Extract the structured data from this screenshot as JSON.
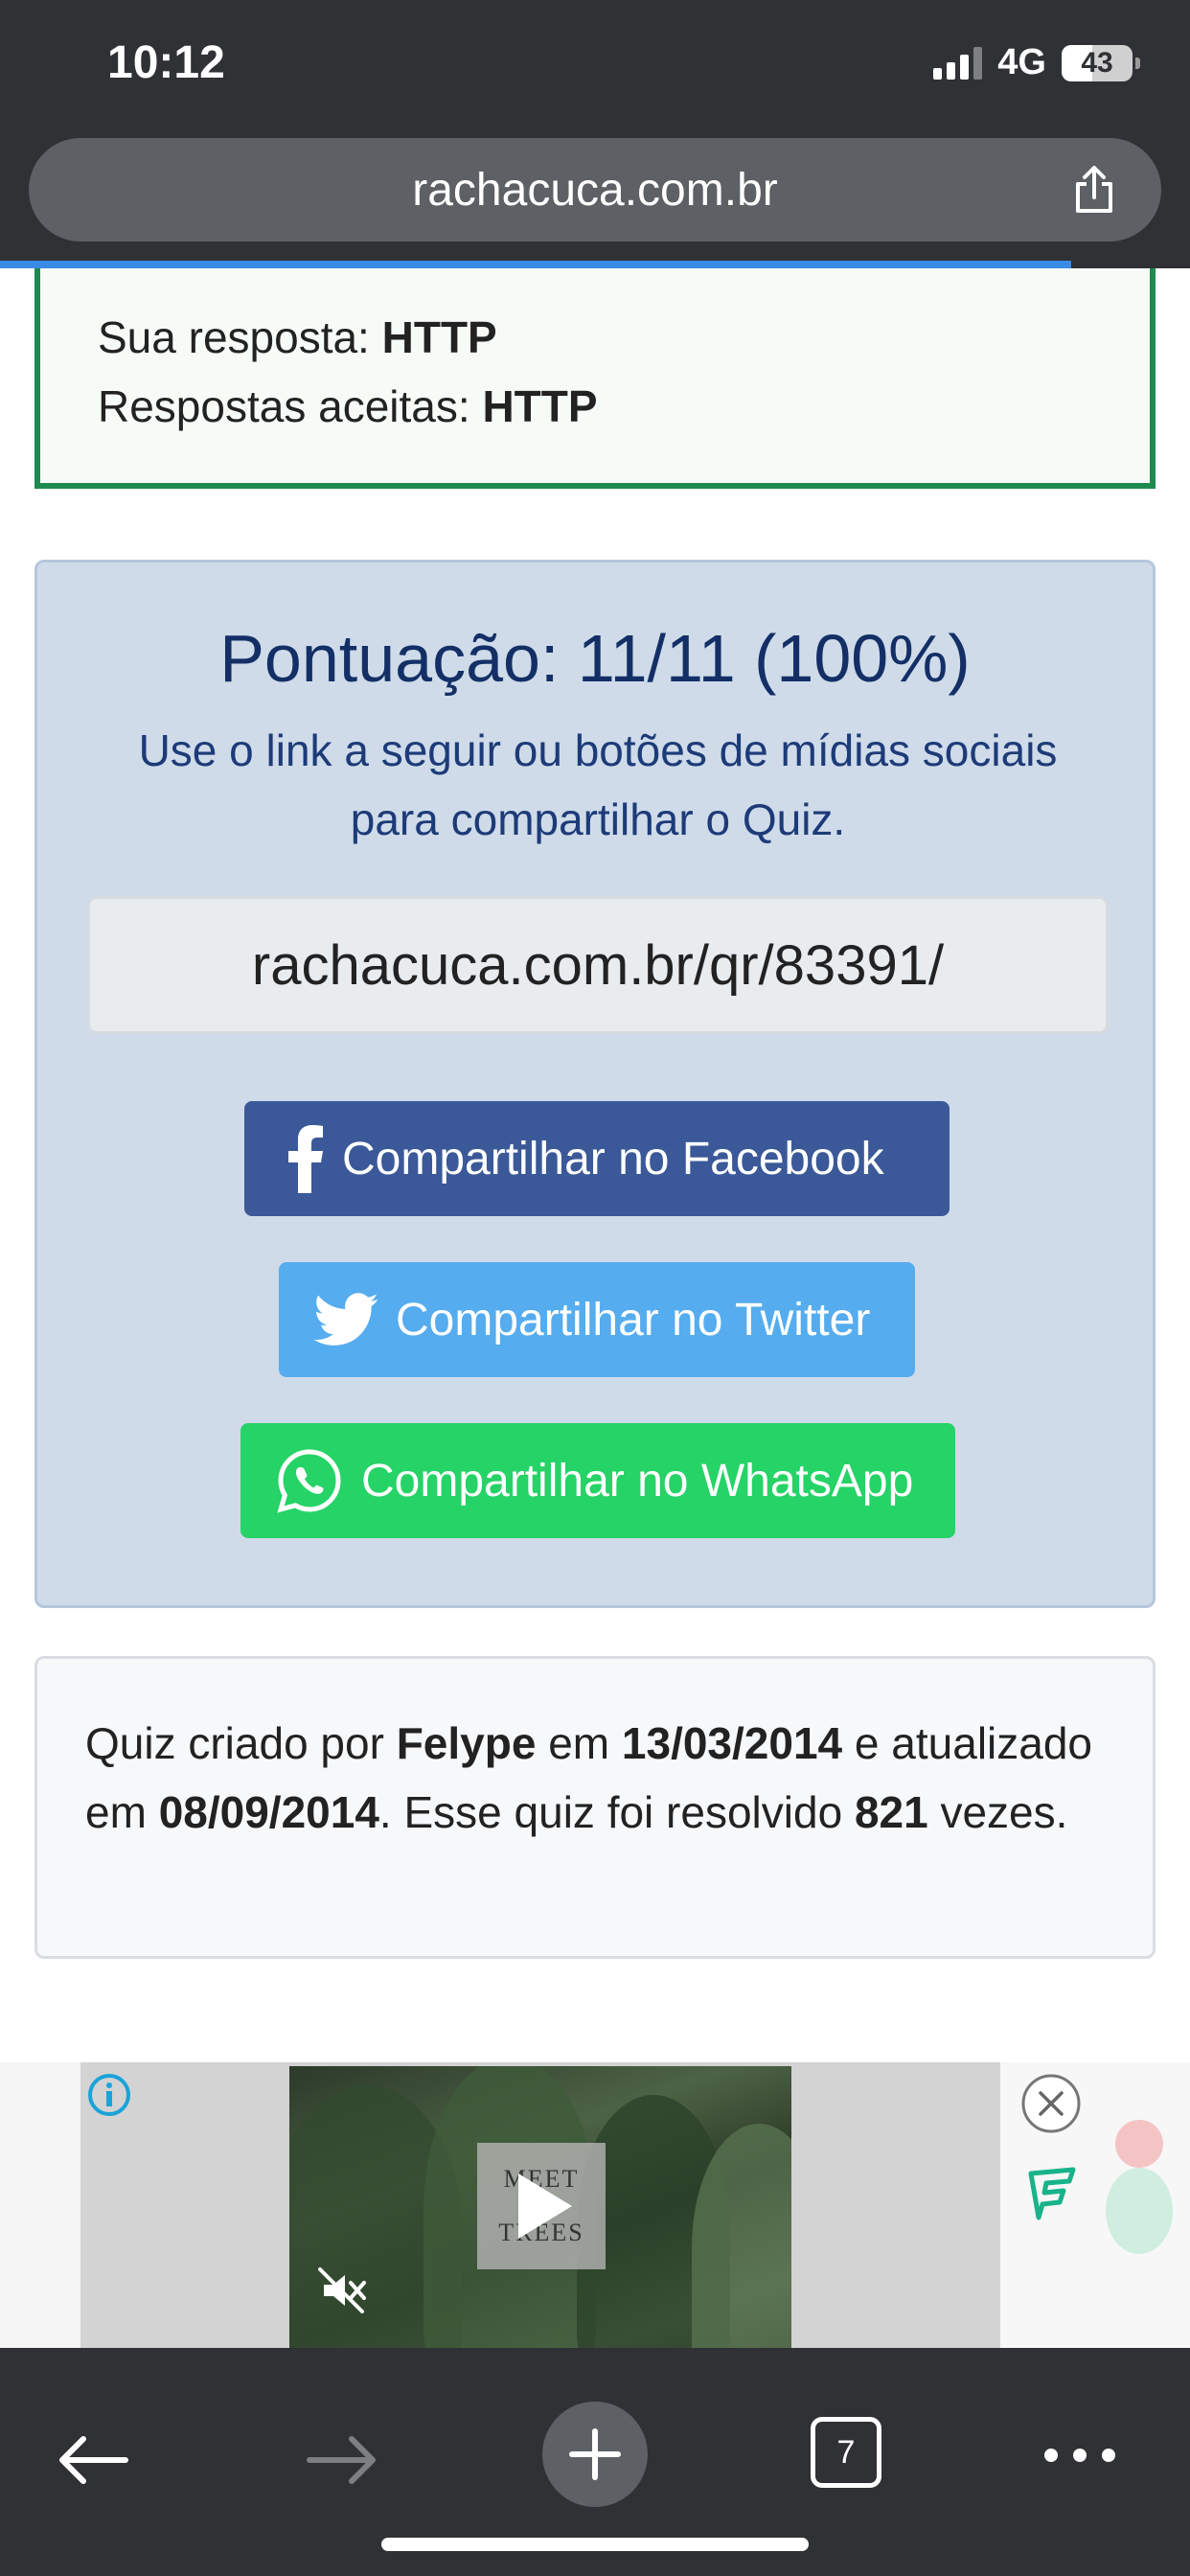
{
  "status_bar": {
    "time": "10:12",
    "network": "4G",
    "battery": "43",
    "battery_level": 0.43
  },
  "browser": {
    "url": "rachacuca.com.br"
  },
  "answer": {
    "your_answer_label": "Sua resposta:",
    "your_answer_value": "HTTP",
    "accepted_label": "Respostas aceitas:",
    "accepted_value": "HTTP"
  },
  "score": {
    "title": "Pontuação: 11/11 (100%)",
    "description": "Use o link a seguir ou botões de mídias sociais para compartilhar o Quiz.",
    "share_link": "rachacuca.com.br/qr/83391/",
    "facebook_label": "Compartilhar no Facebook",
    "twitter_label": "Compartilhar no Twitter",
    "whatsapp_label": "Compartilhar no WhatsApp",
    "colors": {
      "facebook": "#3b5998",
      "twitter": "#55acee",
      "whatsapp": "#25d366"
    }
  },
  "quiz_info": {
    "created_by_text": "Quiz criado por",
    "author": "Felype",
    "em1": "em",
    "created_date": "13/03/2014",
    "updated_text": "e atualizado em",
    "updated_date": "08/09/2014",
    "solved_text": ". Esse quiz foi resolvido",
    "solved_count": "821",
    "times_text": "vezes."
  },
  "ad": {
    "video_text_line1": "MEET",
    "video_text_line2": "TREES"
  },
  "toolbar": {
    "tabs_count": "7"
  }
}
